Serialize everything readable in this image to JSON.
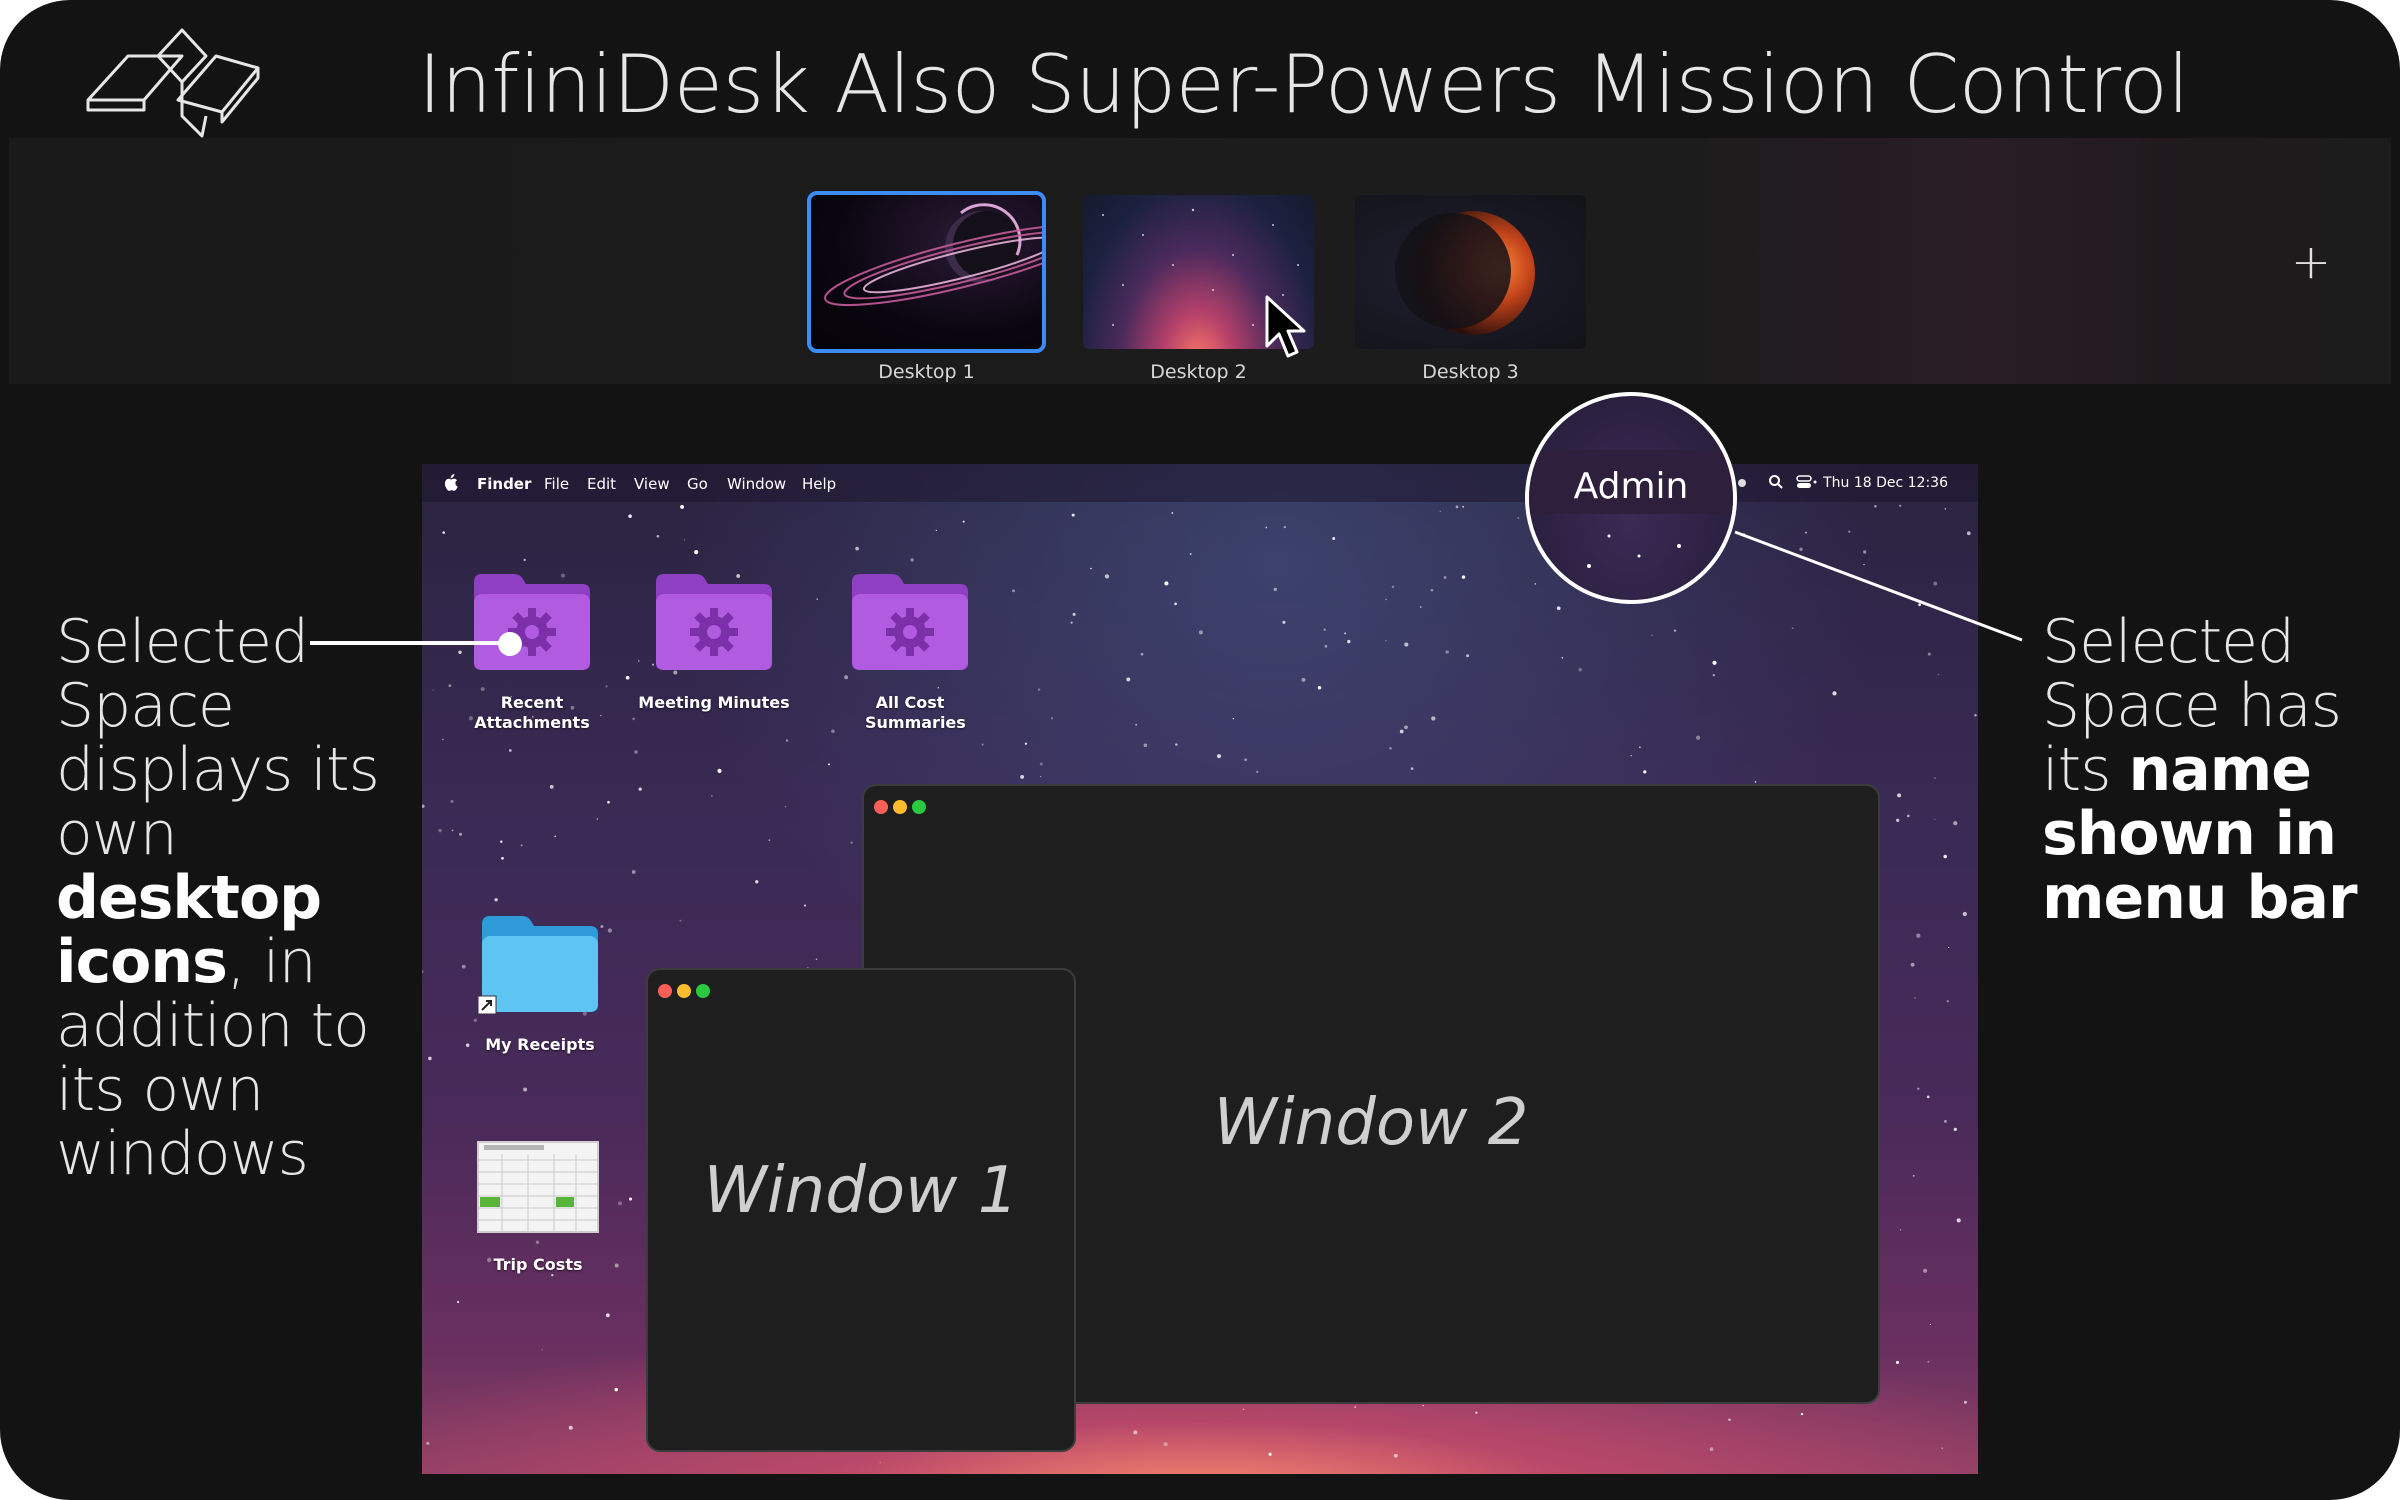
{
  "header": {
    "title": "InfiniDesk Also Super-Powers Mission Control",
    "logo_icon": "infinidesk-logo-icon"
  },
  "spaces": {
    "items": [
      {
        "label": "Desktop 1",
        "selected": true
      },
      {
        "label": "Desktop 2",
        "selected": false
      },
      {
        "label": "Desktop 3",
        "selected": false
      }
    ],
    "add_icon": "plus-icon",
    "selected_color": "#3d8bf5"
  },
  "menu_bar": {
    "app_name": "Finder",
    "menus": [
      "File",
      "Edit",
      "View",
      "Go",
      "Window",
      "Help"
    ],
    "clock": "Thu 18 Dec 12:36"
  },
  "magnifier": {
    "space_name": "Admin"
  },
  "desktop_icons": [
    {
      "label": "Recent Attachments",
      "color": "#a24fd1"
    },
    {
      "label": "Meeting Minutes",
      "color": "#a24fd1"
    },
    {
      "label": "All Cost Summaries",
      "color": "#a24fd1"
    },
    {
      "label": "My Receipts",
      "color": "#4cb8ee"
    },
    {
      "label": "Trip Costs"
    }
  ],
  "windows": [
    {
      "title": "Window 1"
    },
    {
      "title": "Window 2"
    }
  ],
  "callouts": {
    "left": {
      "pre": "Selected Space displays its own",
      "bold": "desktop icons",
      "post": ", in addition to its own windows"
    },
    "right": {
      "pre": "Selected Space has its",
      "bold": "name shown in menu bar"
    }
  }
}
